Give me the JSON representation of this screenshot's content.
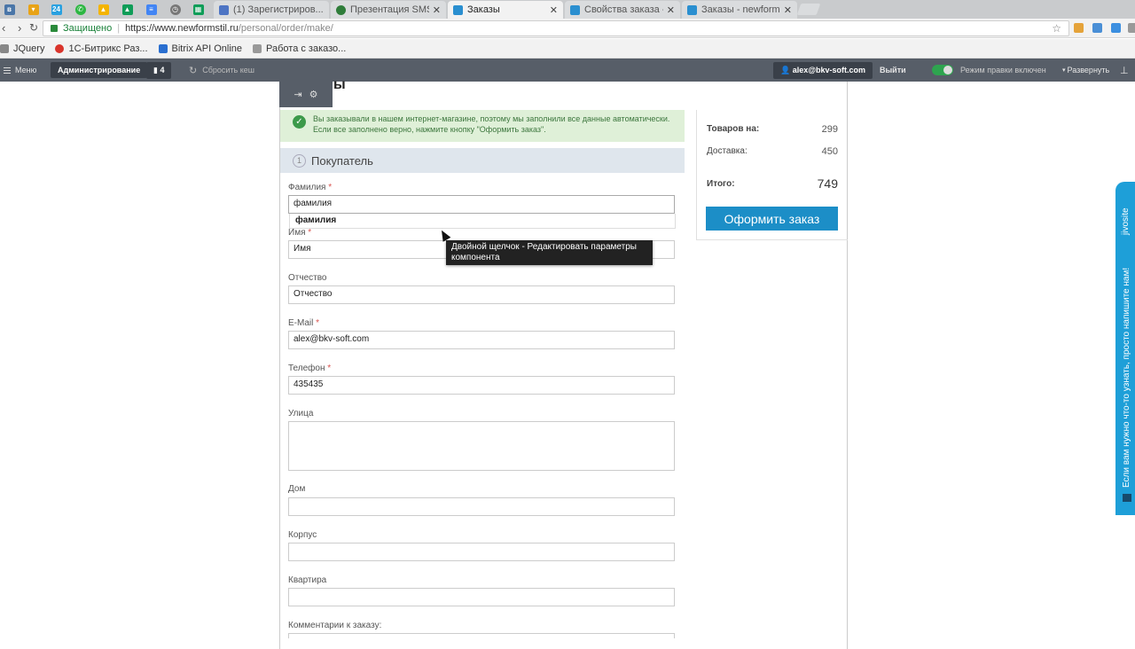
{
  "browser": {
    "tabs": [
      {
        "title": "(1) Зарегистриров...",
        "icon_color": "#4e75c4"
      },
      {
        "title": "Презентация SMS...",
        "icon_color": "#2f7d3a"
      },
      {
        "title": "Заказы",
        "icon_color": "#2a8fd0",
        "active": true
      },
      {
        "title": "Свойства заказа - ...",
        "icon_color": "#2a8fd0"
      },
      {
        "title": "Заказы - newforms...",
        "icon_color": "#2a8fd0"
      }
    ],
    "pinned_badge": "24",
    "address": {
      "secure_label": "Защищено",
      "url_base": "https://www.newformstil.ru",
      "url_path": "/personal/order/make/"
    },
    "bookmarks": [
      {
        "label": "JQuery",
        "icon_color": "#888"
      },
      {
        "label": "1С-Битрикс Раз...",
        "icon_color": "#d9342b"
      },
      {
        "label": "Bitrix API Online",
        "icon_color": "#2a6fd0"
      },
      {
        "label": "Работа с заказо...",
        "icon_color": "#999"
      }
    ]
  },
  "admin": {
    "menu_label": "Меню",
    "admin_label": "Администрирование",
    "notif_count": "4",
    "reset_cache_label": "Сбросить кеш",
    "user_label": "alex@bkv-soft.com",
    "logout_label": "Выйти",
    "edit_mode_label": "Режим правки включен",
    "expand_label": "Развернуть"
  },
  "page": {
    "heading_fragment": "ы",
    "notice_line1": "Вы заказывали в нашем интернет-магазине, поэтому мы заполнили все данные автоматически.",
    "notice_line2": "Если все заполнено верно, нажмите кнопку \"Оформить заказ\".",
    "section_number": "1",
    "section_title": "Покупатель",
    "required_mark": "*",
    "fields": {
      "lastname": {
        "label": "Фамилия",
        "value": "фамилия"
      },
      "firstname": {
        "label": "Имя",
        "value": "Имя"
      },
      "patronymic": {
        "label": "Отчество",
        "value": "Отчество"
      },
      "email": {
        "label": "E-Mail",
        "value": "alex@bkv-soft.com"
      },
      "phone": {
        "label": "Телефон",
        "value": "435435"
      },
      "street": {
        "label": "Улица",
        "value": ""
      },
      "house": {
        "label": "Дом",
        "value": ""
      },
      "building": {
        "label": "Корпус",
        "value": ""
      },
      "apartment": {
        "label": "Квартира",
        "value": ""
      },
      "comments": {
        "label": "Комментарии к заказу:",
        "value": ""
      }
    },
    "autocomplete_suggestion": "фамилия",
    "tooltip_text": "Двойной щелчок - Редактировать параметры компонента"
  },
  "summary": {
    "goods_label": "Товаров на:",
    "goods_value": "299",
    "delivery_label": "Доставка:",
    "delivery_value": "450",
    "total_label": "Итого:",
    "total_value": "749",
    "checkout_label": "Оформить заказ"
  },
  "jivo": {
    "brand": "jivosite",
    "message": "Если вам нужно что-то узнать, просто напишите нам!"
  }
}
